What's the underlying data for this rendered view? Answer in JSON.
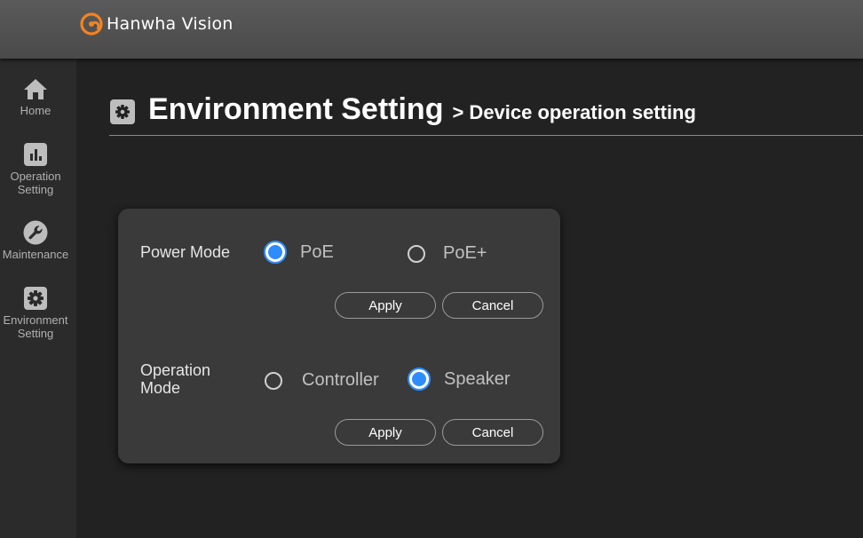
{
  "brand": {
    "name": "Hanwha Vision",
    "logo_icon": "hanwha-logo-icon",
    "accent_color": "#f58220"
  },
  "sidebar": {
    "items": [
      {
        "label": "Home",
        "icon": "home-icon"
      },
      {
        "label": "Operation\nSetting",
        "icon": "bar-chart-icon"
      },
      {
        "label": "Maintenance",
        "icon": "wrench-icon"
      },
      {
        "label": "Environment\nSetting",
        "icon": "gear-icon"
      }
    ]
  },
  "header": {
    "title": "Environment Setting",
    "subtitle": "> Device operation setting",
    "icon": "gear-icon"
  },
  "power_mode": {
    "label": "Power Mode",
    "options": [
      {
        "label": "PoE",
        "selected": true
      },
      {
        "label": "PoE+",
        "selected": false
      }
    ],
    "apply_label": "Apply",
    "cancel_label": "Cancel"
  },
  "operation_mode": {
    "label": "Operation\nMode",
    "options": [
      {
        "label": "Controller",
        "selected": false
      },
      {
        "label": "Speaker",
        "selected": true
      }
    ],
    "apply_label": "Apply",
    "cancel_label": "Cancel"
  },
  "colors": {
    "selected_radio": "#2f8cff",
    "panel_bg": "#3a3a3a",
    "topbar_bg": "#505050"
  }
}
